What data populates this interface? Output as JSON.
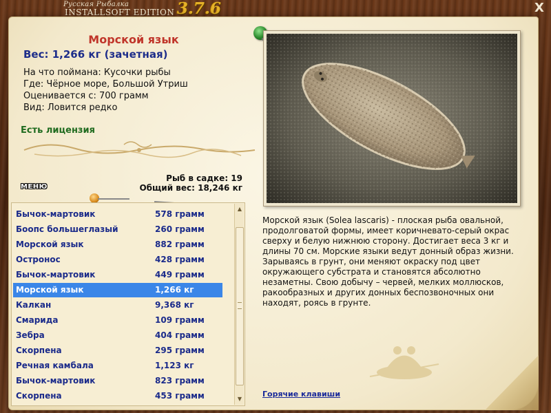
{
  "window": {
    "title_small": "Русская Рыбалка",
    "title_big": "INSTALLSOFT EDITION",
    "version": "3.7.6",
    "close_glyph": "X"
  },
  "fish": {
    "name": "Морской язык",
    "weight": "Вес: 1,266 кг (зачетная)",
    "caught_on": "На что поймана: Кусочки рыбы",
    "location": "Где: Чёрное море, Большой Утриш",
    "valued_from": "Оценивается с: 700 грамм",
    "rarity": "Вид: Ловится редко",
    "license": "Есть лицензия"
  },
  "cage": {
    "count": "Рыб в садке: 19",
    "total_weight": "Общий вес: 18,246 кг"
  },
  "menu_label": "МЕНЮ",
  "catch_list": [
    {
      "name": "Бычок-мартовик",
      "weight": "578 грамм"
    },
    {
      "name": "Боопс большеглазый",
      "weight": "260 грамм"
    },
    {
      "name": "Морской язык",
      "weight": "882 грамм"
    },
    {
      "name": "Остронос",
      "weight": "428 грамм"
    },
    {
      "name": "Бычок-мартовик",
      "weight": "449 грамм"
    },
    {
      "name": "Морской язык",
      "weight": "1,266 кг"
    },
    {
      "name": "Калкан",
      "weight": "9,368 кг"
    },
    {
      "name": "Смарида",
      "weight": "109 грамм"
    },
    {
      "name": "Зебра",
      "weight": "404 грамм"
    },
    {
      "name": "Скорпена",
      "weight": "295 грамм"
    },
    {
      "name": "Речная камбала",
      "weight": "1,123 кг"
    },
    {
      "name": "Бычок-мартовик",
      "weight": "823 грамм"
    },
    {
      "name": "Скорпена",
      "weight": "453 грамм"
    }
  ],
  "selected_index": 5,
  "description": "Морской язык (Solea lascaris) - плоская рыба овальной, продолговатой формы, имеет коричневато-серый окрас сверху и белую нижнюю сторону. Достигает веса 3 кг и длины 70 см. Морские языки ведут донный образ жизни. Зарываясь в грунт, они меняют окраску под цвет окружающего субстрата и становятся абсолютно незаметны. Свою добычу – червей, мелких моллюсков, ракообразных и других донных беспозвоночных они находят, роясь в грунте.",
  "hotkeys_label": "Горячие клавиши",
  "colors": {
    "accent_red": "#c0352a",
    "weight_blue": "#1d2d8a",
    "license_green": "#1f6b1f",
    "selected_row": "#3b86e8",
    "version_gold": "#e5b128"
  }
}
